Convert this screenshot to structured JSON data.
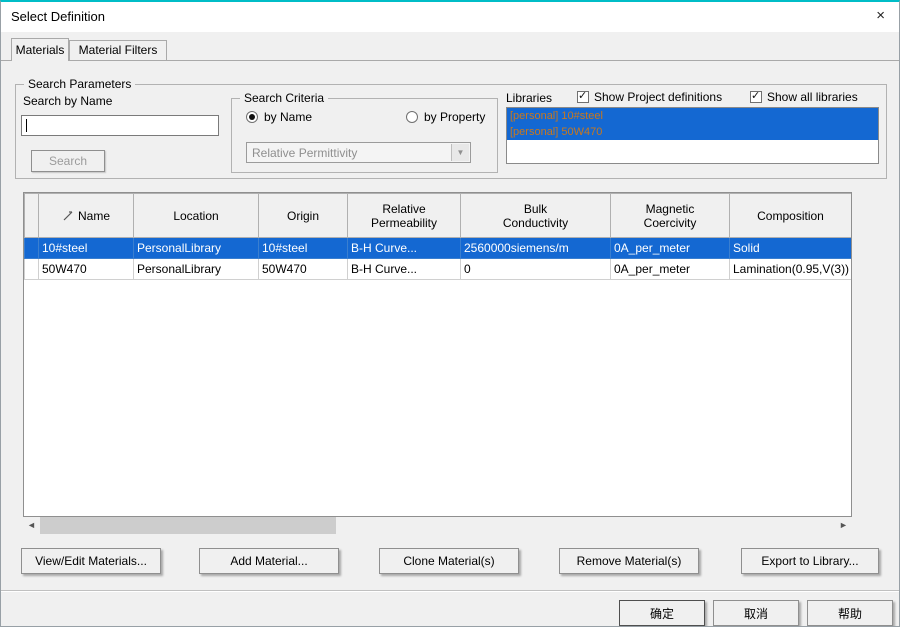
{
  "window": {
    "title": "Select Definition",
    "close_glyph": "×"
  },
  "tabs": {
    "materials": "Materials",
    "material_filters": "Material Filters"
  },
  "search": {
    "group_label": "Search Parameters",
    "by_name_label": "Search by Name",
    "input_value": "",
    "button_label": "Search"
  },
  "criteria": {
    "group_label": "Search Criteria",
    "radio_by_name": "by Name",
    "radio_by_property": "by Property",
    "combo_value": "Relative Permittivity"
  },
  "libraries": {
    "label": "Libraries",
    "checkbox_project": "Show Project definitions",
    "checkbox_all": "Show all libraries",
    "items": [
      "[personal] 10#steel",
      "[personal] 50W470"
    ]
  },
  "table": {
    "headers": {
      "name": "Name",
      "location": "Location",
      "origin": "Origin",
      "rel_perm": "Relative\nPermeability",
      "bulk_cond": "Bulk\nConductivity",
      "mag_coer": "Magnetic\nCoercivity",
      "composition": "Composition"
    },
    "rows": [
      {
        "name": "10#steel",
        "location": "PersonalLibrary",
        "origin": "10#steel",
        "rel_perm": "B-H Curve...",
        "bulk_cond": "2560000siemens/m",
        "mag_coer": "0A_per_meter",
        "composition": "Solid",
        "selected": true
      },
      {
        "name": "50W470",
        "location": "PersonalLibrary",
        "origin": "50W470",
        "rel_perm": "B-H Curve...",
        "bulk_cond": "0",
        "mag_coer": "0A_per_meter",
        "composition": "Lamination(0.95,V(3))",
        "selected": false
      }
    ]
  },
  "actions": {
    "view_edit": "View/Edit Materials...",
    "add": "Add Material...",
    "clone": "Clone Material(s)",
    "remove": "Remove Material(s)",
    "export": "Export to Library..."
  },
  "dialog_buttons": {
    "ok": "确定",
    "cancel": "取消",
    "help": "帮助"
  },
  "icons": {
    "scroll_left": "◄",
    "scroll_right": "►",
    "combo_arrow": "▼",
    "check": "✓"
  },
  "colors": {
    "accent_border": "#00bdc7",
    "selection_blue": "#1468d2",
    "library_item_text": "#c8781e"
  }
}
